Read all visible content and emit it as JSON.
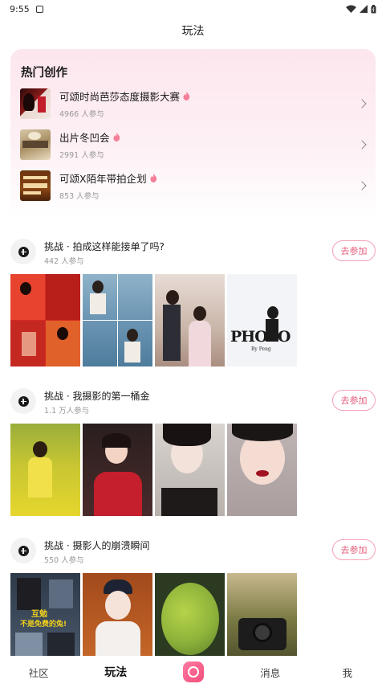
{
  "status_bar": {
    "time": "9:55"
  },
  "header": {
    "title": "玩法"
  },
  "hot_section": {
    "title": "热门创作",
    "items": [
      {
        "name": "可颂时尚芭莎态度摄影大赛",
        "count": "4966 人参与"
      },
      {
        "name": "出片冬凹会",
        "count": "2991 人参与"
      },
      {
        "name": "可颂X陌年带拍企划",
        "count": "853 人参与"
      }
    ]
  },
  "challenges": [
    {
      "title": "挑战 · 拍成这样能接单了吗?",
      "count": "442 人参与",
      "join_label": "去参加",
      "photo_text": "PHOTO",
      "photo_sub": "By Peng"
    },
    {
      "title": "挑战 · 我摄影的第一桶金",
      "count": "1.1 万人参与",
      "join_label": "去参加"
    },
    {
      "title": "挑战 · 摄影人的崩溃瞬间",
      "count": "550 人参与",
      "join_label": "去参加",
      "photo_text_1": "互勉",
      "photo_text_2": "不是免费的兔!"
    }
  ],
  "tab_bar": {
    "tabs": [
      "社区",
      "玩法",
      "消息",
      "我"
    ]
  },
  "colors": {
    "accent": "#e55c7c",
    "card_bg": "#fde6ee"
  }
}
